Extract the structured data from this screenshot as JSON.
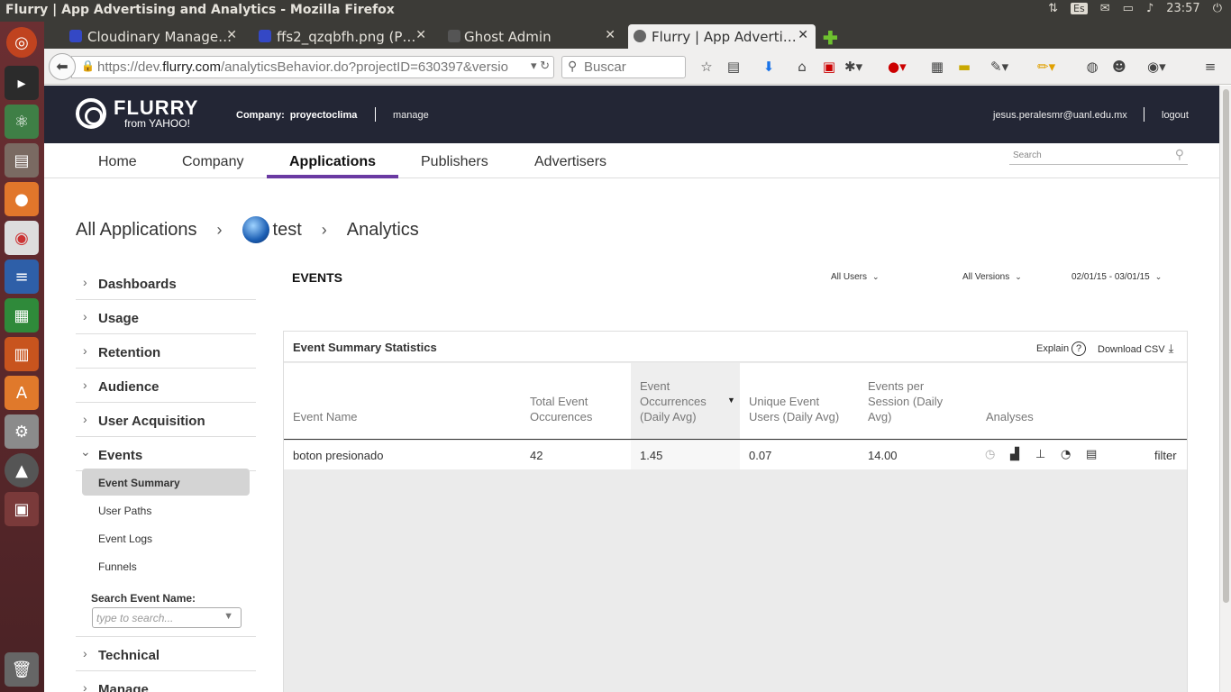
{
  "os": {
    "window_title": "Flurry | App Advertising and Analytics - Mozilla Firefox",
    "keyboard_layout": "Es",
    "clock": "23:57"
  },
  "browser": {
    "tabs": [
      {
        "label": "Cloudinary Manage…",
        "icon": "cloudinary-icon"
      },
      {
        "label": "ffs2_qzqbfh.png (P…",
        "icon": "cloudinary-icon"
      },
      {
        "label": "Ghost Admin",
        "icon": "ghost-icon"
      },
      {
        "label": "Flurry | App Adverti…",
        "icon": "flurry-icon"
      }
    ],
    "url_prefix": "https://dev.",
    "url_domain": "flurry.com",
    "url_suffix": "/analyticsBehavior.do?projectID=630397&versio",
    "search_placeholder": "Buscar"
  },
  "header": {
    "logo_main": "FLURRY",
    "logo_sub": "from YAHOO!",
    "company_label": "Company:",
    "company_name": "proyectoclima",
    "manage": "manage",
    "email": "jesus.peralesmr@uanl.edu.mx",
    "logout": "logout"
  },
  "mainnav": {
    "items": [
      "Home",
      "Company",
      "Applications",
      "Publishers",
      "Advertisers"
    ],
    "active": "Applications",
    "search_placeholder": "Search"
  },
  "breadcrumb": {
    "all": "All Applications",
    "app": "test",
    "section": "Analytics"
  },
  "sidenav": {
    "sections": [
      "Dashboards",
      "Usage",
      "Retention",
      "Audience",
      "User Acquisition",
      "Events",
      "Technical",
      "Manage"
    ],
    "events_items": [
      "Event Summary",
      "User Paths",
      "Event Logs",
      "Funnels"
    ],
    "active_item": "Event Summary",
    "search_label": "Search Event Name:",
    "search_placeholder": "type to search..."
  },
  "content": {
    "title": "EVENTS",
    "filter_users": "All Users",
    "filter_versions": "All Versions",
    "filter_dates": "02/01/15 - 03/01/15",
    "panel_title": "Event Summary Statistics",
    "explain": "Explain",
    "download": "Download CSV",
    "columns": [
      "Event Name",
      "Total Event Occurences",
      "Event Occurrences (Daily Avg)",
      "Unique Event Users (Daily Avg)",
      "Events per Session (Daily Avg)",
      "Analyses"
    ],
    "sorted_column": "Event Occurrences (Daily Avg)",
    "rows": [
      {
        "name": "boton presionado",
        "total": "42",
        "daily_avg": "1.45",
        "unique_users": "0.07",
        "per_session": "14.00",
        "filter": "filter"
      }
    ],
    "analysis_icons": [
      "clock-icon",
      "bar-chart-icon",
      "hierarchy-icon",
      "pie-chart-icon",
      "log-icon"
    ]
  }
}
